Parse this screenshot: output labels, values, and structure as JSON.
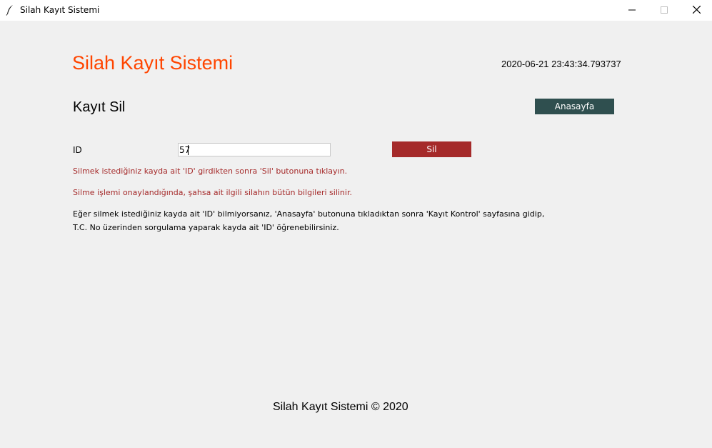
{
  "window": {
    "title": "Silah Kayıt Sistemi"
  },
  "app": {
    "title": "Silah Kayıt Sistemi",
    "timestamp": "2020-06-21 23:43:34.793737"
  },
  "section": {
    "title": "Kayıt Sil",
    "home_button": "Anasayfa"
  },
  "form": {
    "id_label": "ID",
    "id_value": "57",
    "delete_button": "Sil"
  },
  "messages": {
    "instruction": "Silmek istediğiniz kayda ait 'ID' girdikten sonra 'Sil' butonuna tıklayın.",
    "warning": "Silme işlemi onaylandığında, şahsa ait ilgili silahın bütün bilgileri silinir.",
    "help_line1": "Eğer silmek istediğiniz kayda ait 'ID' bilmiyorsanız, 'Anasayfa' butonuna tıkladıktan sonra 'Kayıt Kontrol' sayfasına gidip,",
    "help_line2": "T.C. No üzerinden sorgulama yaparak kayda ait 'ID' öğrenebilirsiniz."
  },
  "footer": {
    "text": "Silah Kayıt Sistemi © 2020"
  },
  "colors": {
    "title_accent": "#ff4500",
    "home_button_bg": "#2f4f4f",
    "delete_button_bg": "#a52a2a",
    "message_red": "#a52a2a",
    "background": "#f0f0f0"
  },
  "icons": {
    "app": "feather-icon",
    "minimize": "minimize-icon",
    "maximize": "maximize-icon",
    "close": "close-icon"
  }
}
